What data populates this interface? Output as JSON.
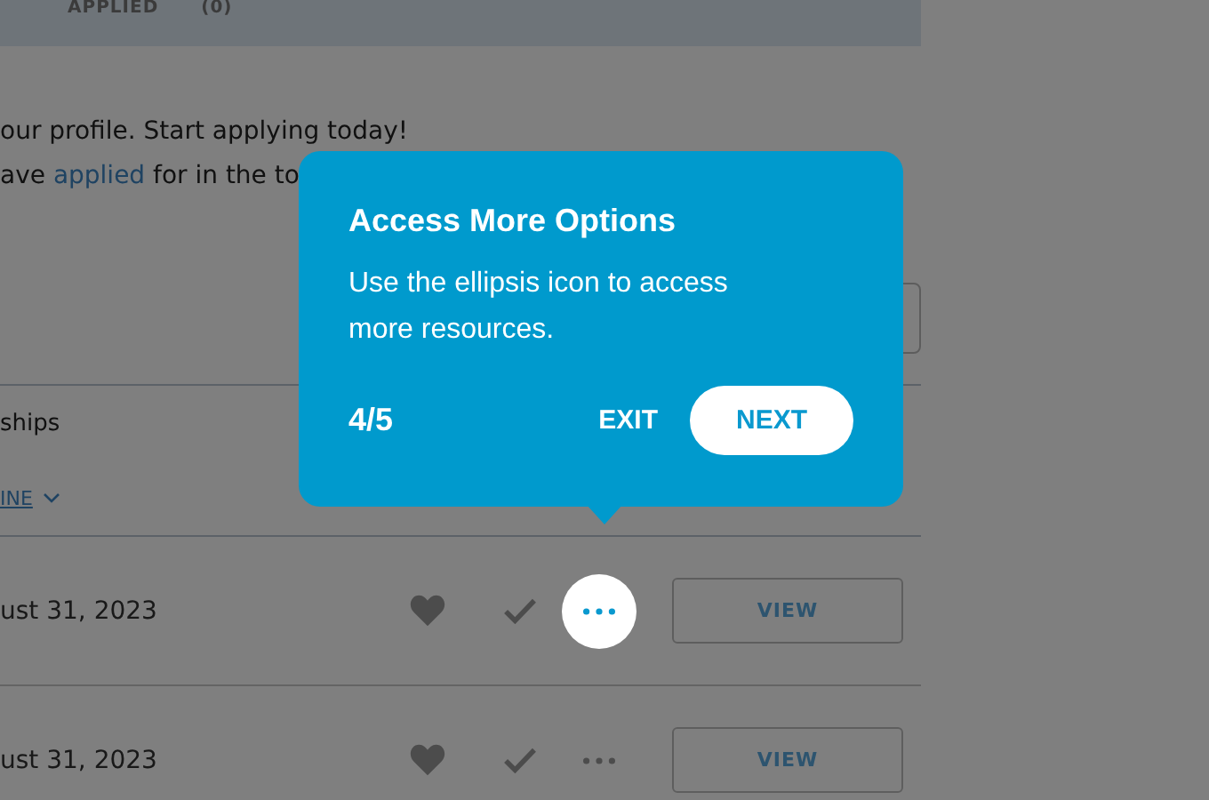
{
  "tabs": [
    {
      "label": "APPLIED",
      "count": "(0)"
    }
  ],
  "intro": {
    "line_1": "our profile. Start applying today!",
    "line_2": {
      "before": "ave ",
      "link": "applied",
      "after": " for in the to"
    }
  },
  "filter": {
    "label": "ships",
    "link": "INE"
  },
  "rows": [
    {
      "date": "ust 31, 2023",
      "more_highlighted": true,
      "button": "VIEW"
    },
    {
      "date": "ust 31, 2023",
      "more_highlighted": false,
      "button": "VIEW"
    }
  ],
  "tour": {
    "title": "Access More Options",
    "body": "Use the ellipsis icon to access more resources.",
    "step": "4/5",
    "exit": "EXIT",
    "next": "NEXT"
  }
}
